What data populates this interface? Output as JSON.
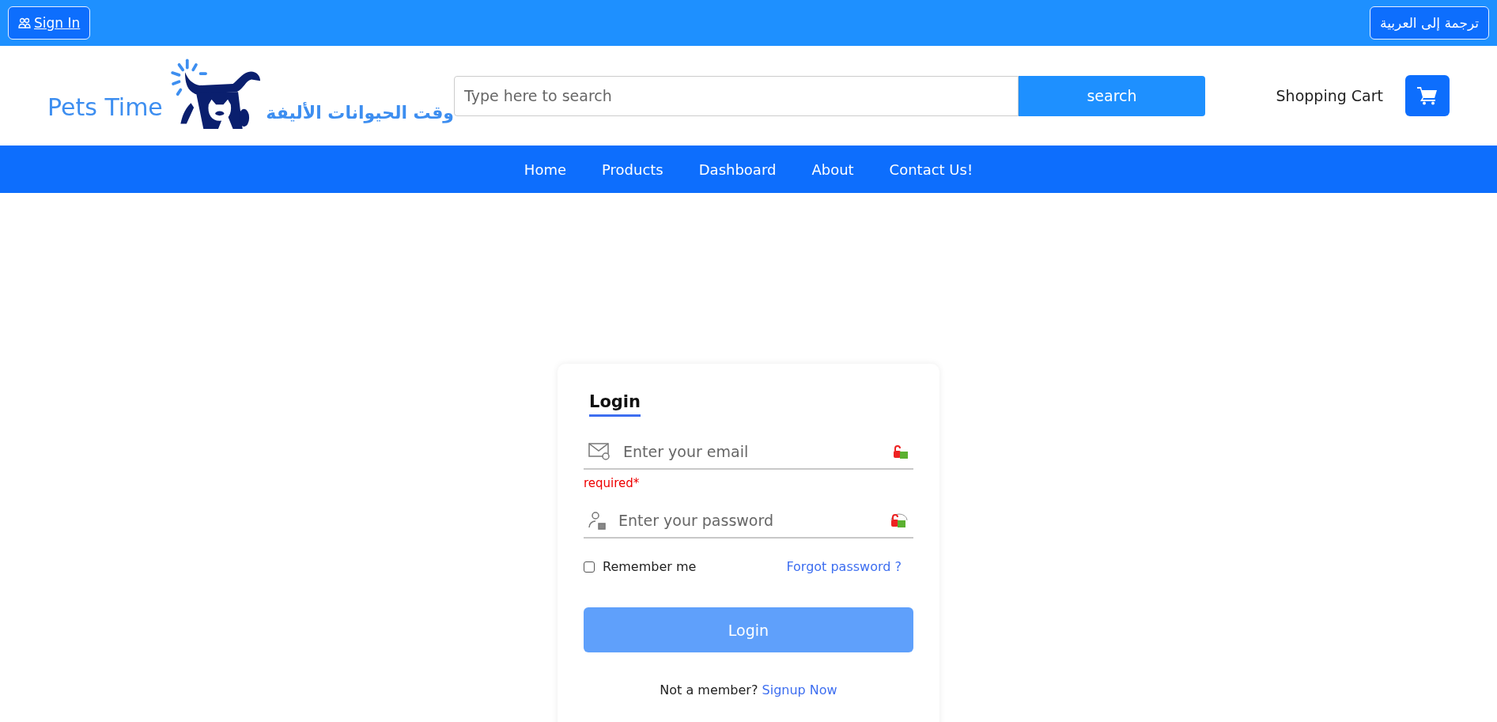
{
  "top_bar": {
    "sign_in": "Sign In",
    "translate": "ترجمة إلى العربية"
  },
  "header": {
    "logo": {
      "name": "Pets Time",
      "tagline": "وقت الحيوانات الأليفة"
    },
    "search": {
      "placeholder": "Type here to search",
      "button": "search"
    },
    "cart": {
      "label": "Shopping Cart"
    }
  },
  "nav": [
    {
      "label": "Home"
    },
    {
      "label": "Products"
    },
    {
      "label": "Dashboard"
    },
    {
      "label": "About"
    },
    {
      "label": "Contact Us!"
    }
  ],
  "login": {
    "title": "Login",
    "email": {
      "placeholder": "Enter your email",
      "error": "required*"
    },
    "password": {
      "placeholder": "Enter your password"
    },
    "remember": {
      "label": "Remember me",
      "checked": false
    },
    "forgot": "Forgot password ?",
    "submit": "Login",
    "footer": {
      "text": "Not a member?",
      "link": "Signup Now"
    }
  }
}
